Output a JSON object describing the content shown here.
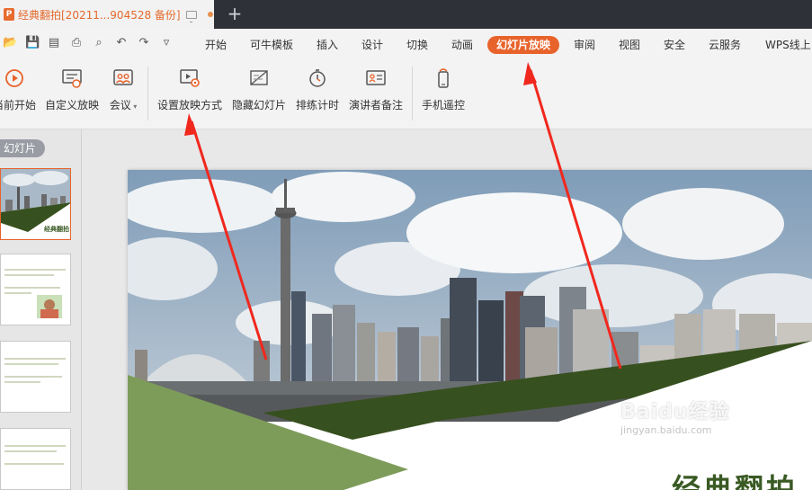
{
  "window": {
    "doc_tab_title": "经典翻拍[20211...904528 备份]",
    "new_tab_symbol": "+"
  },
  "quick_access": [
    {
      "icon": "open-folder-icon",
      "glyph": "📂"
    },
    {
      "icon": "save-icon",
      "glyph": "💾"
    },
    {
      "icon": "export-pdf-icon",
      "glyph": "▤"
    },
    {
      "icon": "print-icon",
      "glyph": "⎙"
    },
    {
      "icon": "print-preview-icon",
      "glyph": "⌕"
    },
    {
      "icon": "undo-icon",
      "glyph": "↶"
    },
    {
      "icon": "redo-icon",
      "glyph": "↷"
    },
    {
      "icon": "customize-dropdown-icon",
      "glyph": "▿"
    }
  ],
  "menu": {
    "tabs": [
      "开始",
      "可牛模板",
      "插入",
      "设计",
      "切换",
      "动画",
      "幻灯片放映",
      "审阅",
      "视图",
      "安全",
      "云服务",
      "WPS线上"
    ],
    "active": "幻灯片放映"
  },
  "ribbon": {
    "from_current": "当前开始",
    "custom_show": "自定义放映",
    "meeting": "会议",
    "setup_show": "设置放映方式",
    "hide_slide": "隐藏幻灯片",
    "rehearse_timings": "排练计时",
    "presenter_notes": "演讲者备注",
    "phone_remote": "手机遥控"
  },
  "slides_pane": {
    "tab_label": "幻灯片",
    "thumb1_caption": "经典翻拍"
  },
  "slide": {
    "title": "经典翻拍"
  },
  "watermark": {
    "brand": "Baidu经验",
    "url": "jingyan.baidu.com"
  },
  "colors": {
    "accent": "#e8632b",
    "dark_green": "#37501f",
    "light_green": "#7d9c5a"
  }
}
